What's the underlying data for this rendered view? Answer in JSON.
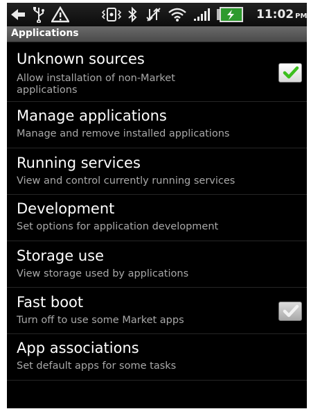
{
  "status_bar": {
    "icons": [
      "back-arrow-icon",
      "usb-icon",
      "warning-icon",
      "vibrate-icon",
      "bluetooth-icon",
      "no-data-icon",
      "wifi-icon",
      "signal-icon",
      "battery-charging-icon"
    ],
    "time": "11:02",
    "ampm": "PM"
  },
  "header": {
    "title": "Applications"
  },
  "settings": {
    "items": [
      {
        "title": "Unknown sources",
        "subtitle": "Allow installation of non-Market applications",
        "checkbox": true,
        "checked": true,
        "enabled": true
      },
      {
        "title": "Manage applications",
        "subtitle": "Manage and remove installed applications"
      },
      {
        "title": "Running services",
        "subtitle": "View and control currently running services"
      },
      {
        "title": "Development",
        "subtitle": "Set options for application development"
      },
      {
        "title": "Storage use",
        "subtitle": "View storage used by applications"
      },
      {
        "title": "Fast boot",
        "subtitle": "Turn off to use some Market apps",
        "checkbox": true,
        "checked": true,
        "enabled": false
      },
      {
        "title": "App associations",
        "subtitle": "Set default apps for some tasks"
      }
    ]
  },
  "colors": {
    "check_green": "#3cbf1e",
    "subtitle_gray": "#a9a9a9",
    "background": "#000000"
  }
}
